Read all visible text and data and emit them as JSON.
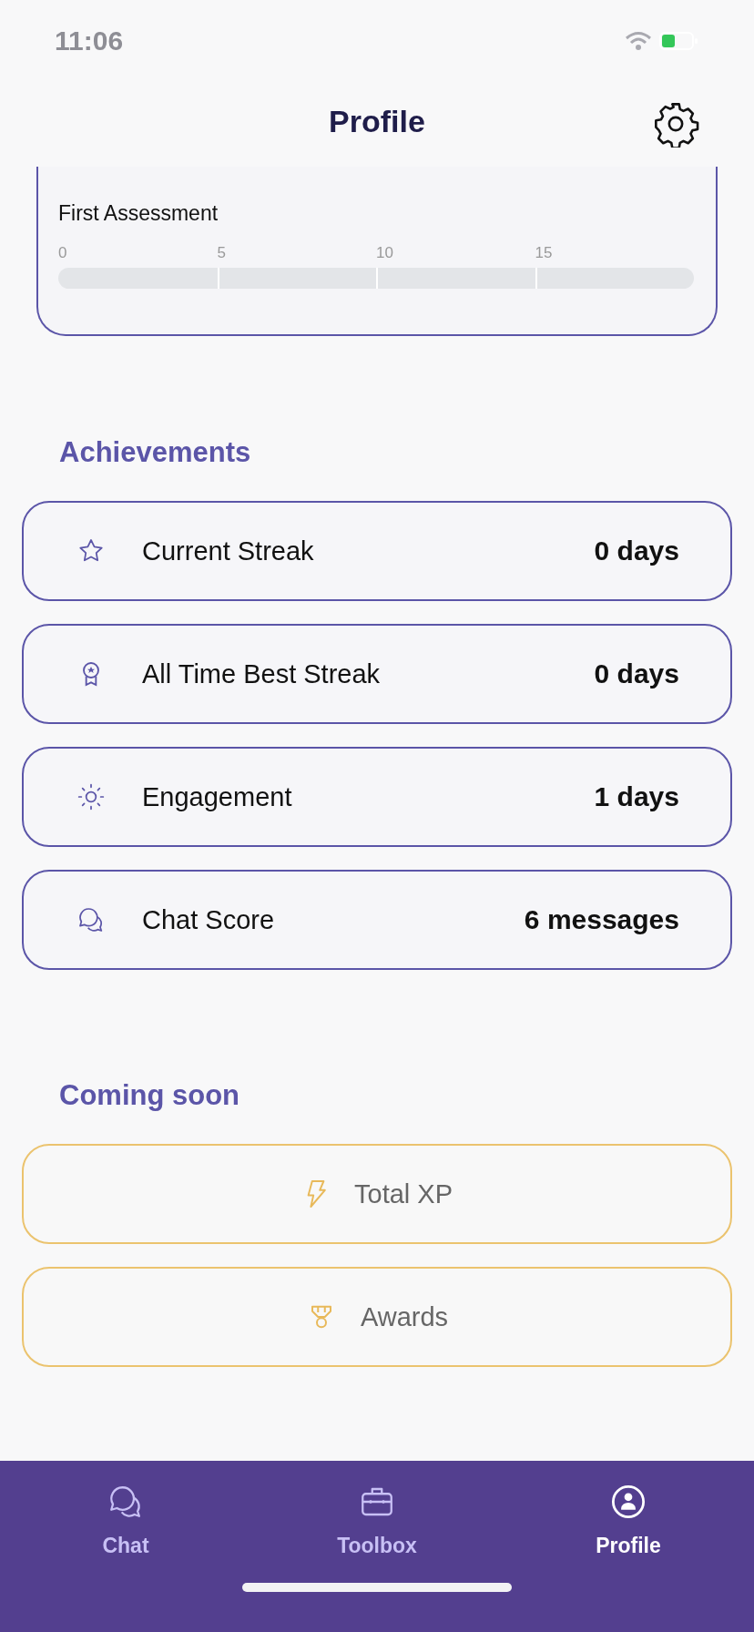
{
  "status_bar": {
    "time": "11:06"
  },
  "header": {
    "title": "Profile"
  },
  "assessment_card": {
    "title": "First Assessment",
    "ticks": [
      "0",
      "5",
      "10",
      "15"
    ]
  },
  "achievements": {
    "title": "Achievements",
    "items": [
      {
        "kind": "star",
        "label": "Current Streak",
        "value": "0 days"
      },
      {
        "kind": "medal",
        "label": "All Time Best Streak",
        "value": "0 days"
      },
      {
        "kind": "sun",
        "label": "Engagement",
        "value": "1 days"
      },
      {
        "kind": "chat",
        "label": "Chat Score",
        "value": "6 messages"
      }
    ]
  },
  "coming_soon": {
    "title": "Coming soon",
    "items": [
      {
        "kind": "bolt",
        "label": "Total XP"
      },
      {
        "kind": "trophy",
        "label": "Awards"
      }
    ]
  },
  "tab_bar": [
    {
      "kind": "chat",
      "label": "Chat",
      "selected": false
    },
    {
      "kind": "toolbox",
      "label": "Toolbox",
      "selected": false
    },
    {
      "kind": "profile",
      "label": "Profile",
      "selected": true
    }
  ]
}
